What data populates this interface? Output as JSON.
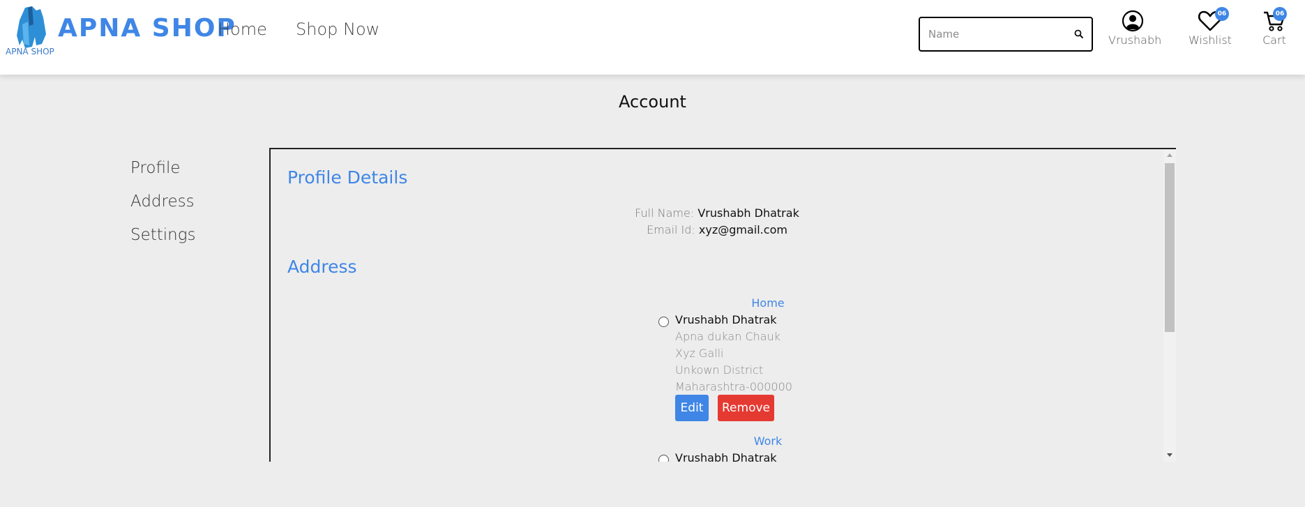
{
  "header": {
    "logo_caption": "APNA SHOP",
    "brand": "APNA SHOP",
    "nav": [
      "Home",
      "Shop Now"
    ],
    "search_placeholder": "Name",
    "user_label": "Vrushabh",
    "wishlist_label": "Wishlist",
    "wishlist_count": "06",
    "cart_label": "Cart",
    "cart_count": "06",
    "accent_color": "#3f86e6"
  },
  "page": {
    "title": "Account"
  },
  "sidebar": {
    "items": [
      "Profile",
      "Address",
      "Settings"
    ]
  },
  "profile": {
    "heading": "Profile Details",
    "full_name_label": "Full Name:",
    "full_name": "Vrushabh Dhatrak",
    "email_label": "Email Id:",
    "email": "xyz@gmail.com"
  },
  "address": {
    "heading": "Address",
    "entries": [
      {
        "type": "Home",
        "name": "Vrushabh Dhatrak",
        "lines": [
          "Apna dukan Chauk",
          "Xyz Galli",
          "Unkown District",
          "Maharashtra-000000"
        ],
        "edit_label": "Edit",
        "remove_label": "Remove"
      },
      {
        "type": "Work",
        "name": "Vrushabh Dhatrak"
      }
    ],
    "edit_color": "#3f86e6",
    "remove_color": "#e53a32"
  }
}
